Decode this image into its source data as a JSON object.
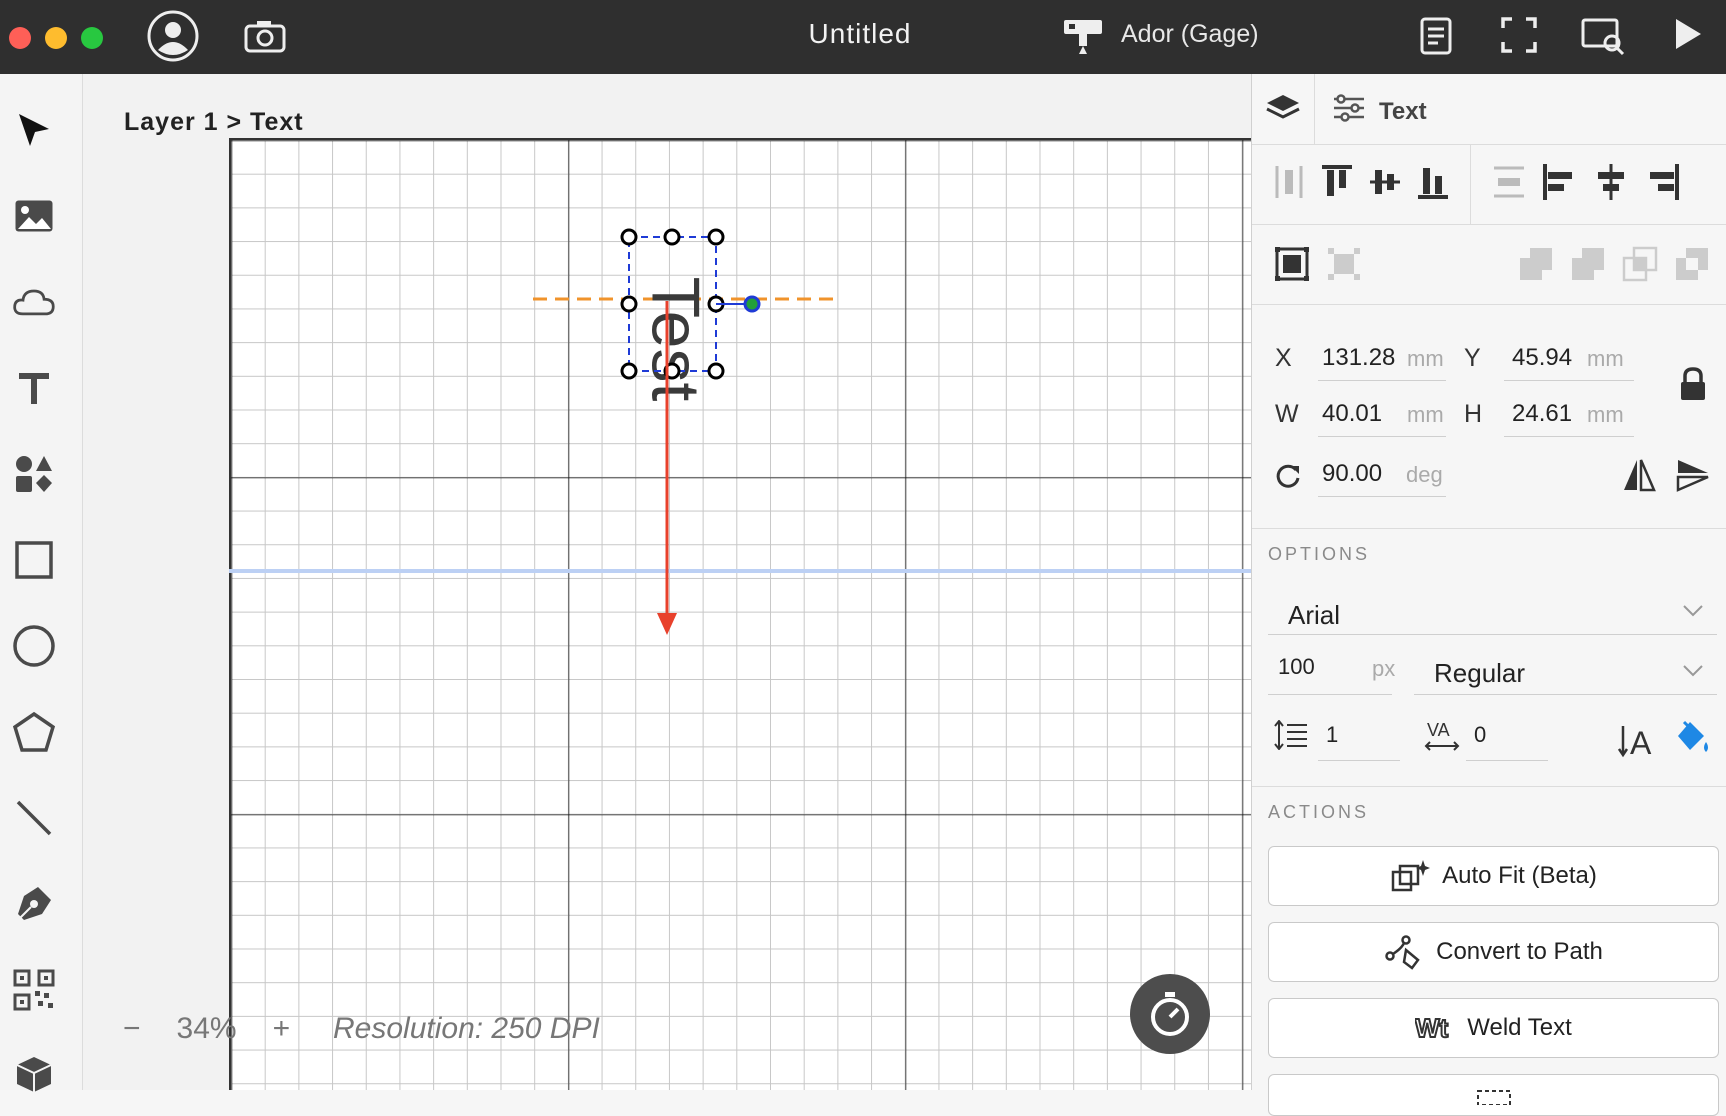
{
  "window": {
    "title": "Untitled",
    "machine": "Ador (Gage)"
  },
  "canvas": {
    "breadcrumb": "Layer 1 > Text",
    "text_object": "Test",
    "zoom": {
      "minus": "−",
      "value": "34%",
      "plus": "+"
    },
    "resolution": "Resolution: 250 DPI"
  },
  "toolbar": {
    "tools": [
      "select-tool",
      "image-tool",
      "cloud-tool",
      "text-tool",
      "elements-tool",
      "rectangle-tool",
      "ellipse-tool",
      "polygon-tool",
      "line-tool",
      "pen-tool",
      "qrcode-tool",
      "3d-tool"
    ]
  },
  "panel": {
    "header": {
      "object_tab": "Text"
    },
    "position": {
      "x_label": "X",
      "x_value": "131.28",
      "x_unit": "mm",
      "y_label": "Y",
      "y_value": "45.94",
      "y_unit": "mm",
      "w_label": "W",
      "w_value": "40.01",
      "w_unit": "mm",
      "h_label": "H",
      "h_value": "24.61",
      "h_unit": "mm",
      "rotation_value": "90.00",
      "rotation_unit": "deg"
    },
    "options": {
      "title": "OPTIONS",
      "font_family": "Arial",
      "font_size": "100",
      "font_size_unit": "px",
      "font_style": "Regular",
      "line_spacing": "1",
      "letter_spacing": "0"
    },
    "actions": {
      "title": "ACTIONS",
      "auto_fit": "Auto Fit (Beta)",
      "convert_to_path": "Convert to Path",
      "weld_text": "Weld Text"
    }
  },
  "colors": {
    "accent": "#1e88e5",
    "guide_orange": "#f0932b",
    "arrow_red": "#e8412c",
    "selection_blue": "#1f3bd6"
  }
}
